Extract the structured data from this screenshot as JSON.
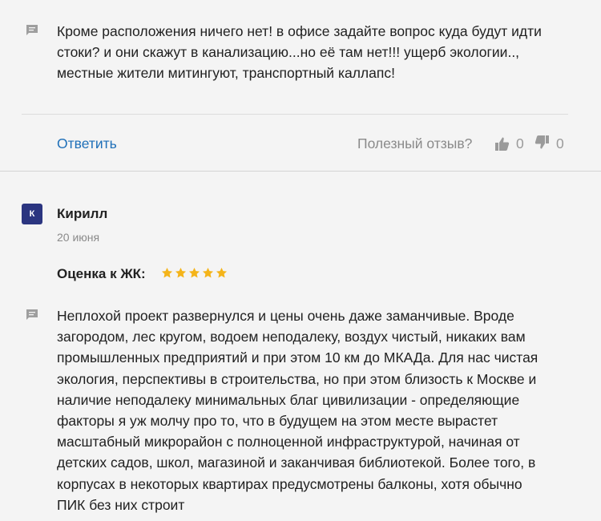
{
  "review_top": {
    "text_lines": [
      "Кроме расположения ничего нет! в офисе задайте вопрос куда будут идти",
      "стоки? и они скажут в канализацию...но её там нет!!! ущерб экологии..,",
      "местные жители митингуют, транспортный каллапс!"
    ],
    "reply_label": "Ответить",
    "helpful_label": "Полезный отзыв?",
    "likes": "0",
    "dislikes": "0"
  },
  "review_second": {
    "avatar_letter": "К",
    "author": "Кирилл",
    "date": "20 июня",
    "rating_label": "Оценка к ЖК:",
    "rating": 5,
    "rating_max": 5,
    "text_lines": [
      "Неплохой проект развернулся и цены очень даже заманчивые. Вроде",
      "загородом, лес кругом, водоем неподалеку, воздух чистый, никаких вам",
      "промышленных предприятий и при этом 10 км до МКАДа. Для нас чистая",
      "экология, перспективы в строительства, но при этом близость к Москве и",
      "наличие неподалеку минимальных благ цивилизации - определяющие",
      "факторы я уж молчу про то, что в будущем на этом месте вырастет",
      "масштабный микрорайон с полноценной инфраструктурой, начиная от",
      "детских садов, школ, магазиной и заканчивая библиотекой. Более того, в",
      "корпусах в некоторых квартирах предусмотрены балконы, хотя обычно",
      "ПИК без них строит"
    ]
  },
  "colors": {
    "link": "#1e6fb8",
    "avatar_bg": "#2b3580",
    "star": "#f4b41a",
    "muted": "#8a8a8a"
  },
  "icons": {
    "comment": "comment-icon",
    "like": "thumbs-up-icon",
    "dislike": "thumbs-down-icon",
    "star": "star-icon"
  }
}
